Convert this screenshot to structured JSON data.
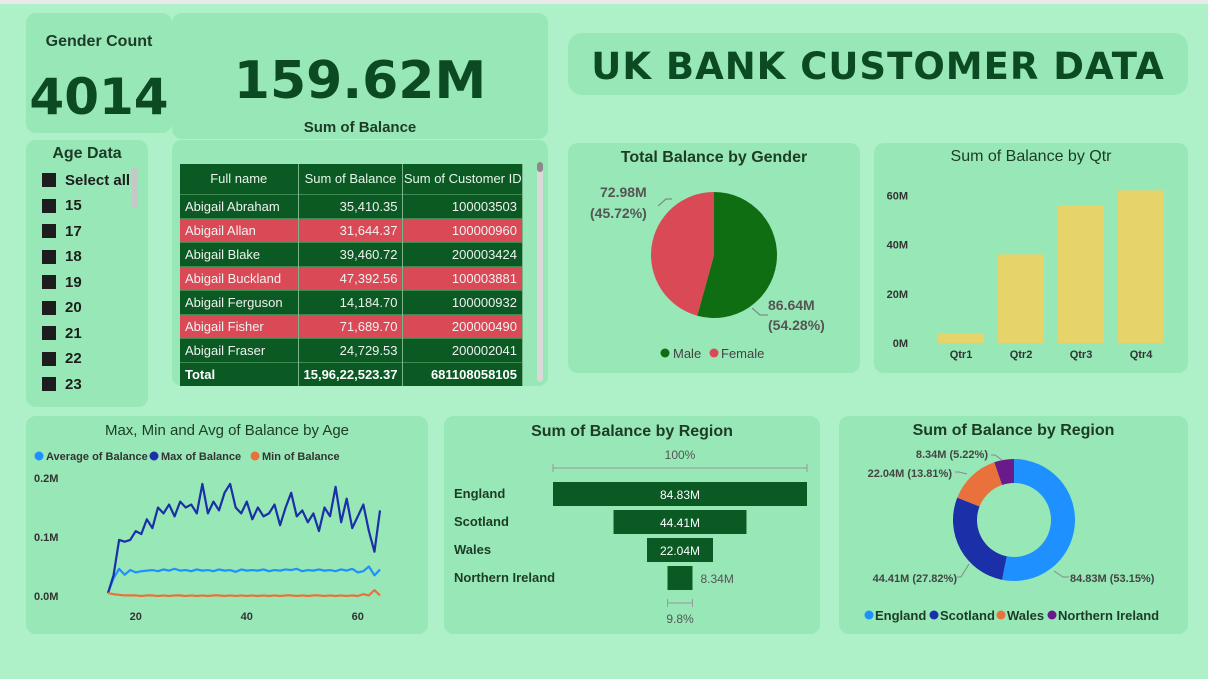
{
  "gender_count": {
    "title": "Gender Count",
    "value": "4014"
  },
  "balance_kpi": {
    "value": "159.62M",
    "label": "Sum of Balance"
  },
  "dashboard_title": "UK BANK CUSTOMER DATA",
  "age_filter": {
    "title": "Age Data",
    "items": [
      "Select all",
      "15",
      "17",
      "18",
      "19",
      "20",
      "21",
      "22",
      "23"
    ]
  },
  "customer_table": {
    "headers": [
      "Full name",
      "Sum of Balance",
      "Sum of Customer ID"
    ],
    "rows": [
      {
        "name": "Abigail Abraham",
        "balance": "35,410.35",
        "id": "100003503",
        "flag": "g"
      },
      {
        "name": "Abigail Allan",
        "balance": "31,644.37",
        "id": "100000960",
        "flag": "r"
      },
      {
        "name": "Abigail Blake",
        "balance": "39,460.72",
        "id": "200003424",
        "flag": "g"
      },
      {
        "name": "Abigail Buckland",
        "balance": "47,392.56",
        "id": "100003881",
        "flag": "r"
      },
      {
        "name": "Abigail Ferguson",
        "balance": "14,184.70",
        "id": "100000932",
        "flag": "g"
      },
      {
        "name": "Abigail Fisher",
        "balance": "71,689.70",
        "id": "200000490",
        "flag": "r"
      },
      {
        "name": "Abigail Fraser",
        "balance": "24,729.53",
        "id": "200002041",
        "flag": "g"
      }
    ],
    "total": {
      "label": "Total",
      "balance": "15,96,22,523.37",
      "id": "681108058105"
    }
  },
  "colors": {
    "male": "#0f6e12",
    "female": "#d94a56",
    "bar": "#e6d36a",
    "avg": "#1e90ff",
    "max": "#1a2fa8",
    "min": "#e8713c",
    "england": "#1e90ff",
    "scotland": "#1a2fa8",
    "wales": "#e8713c",
    "ni": "#6a1a8a",
    "funnel": "#0b5a24"
  },
  "chart_data": [
    {
      "type": "pie",
      "title": "Total Balance by Gender",
      "labels": [
        "Male",
        "Female"
      ],
      "values": [
        86.64,
        72.98
      ],
      "value_labels": [
        "86.64M",
        "72.98M"
      ],
      "percent_labels": [
        "(54.28%)",
        "(45.72%)"
      ],
      "percents": [
        54.28,
        45.72
      ],
      "legend": "bottom"
    },
    {
      "type": "bar",
      "title": "Sum of Balance by Qtr",
      "categories": [
        "Qtr1",
        "Qtr2",
        "Qtr3",
        "Qtr4"
      ],
      "values": [
        4,
        36,
        56,
        62
      ],
      "y_ticks": [
        "0M",
        "20M",
        "40M",
        "60M"
      ],
      "ylim": [
        0,
        65
      ]
    },
    {
      "type": "line",
      "title": "Max, Min and Avg of Balance by Age",
      "series_names": [
        "Average of Balance",
        "Max of Balance",
        "Min of Balance"
      ],
      "x_ticks": [
        "20",
        "40",
        "60"
      ],
      "y_ticks": [
        "0.0M",
        "0.1M",
        "0.2M"
      ],
      "xlim": [
        15,
        64
      ],
      "ylim": [
        0,
        0.2
      ],
      "x": [
        15,
        16,
        17,
        18,
        19,
        20,
        21,
        22,
        23,
        24,
        25,
        26,
        27,
        28,
        29,
        30,
        31,
        32,
        33,
        34,
        35,
        36,
        37,
        38,
        39,
        40,
        41,
        42,
        43,
        44,
        45,
        46,
        47,
        48,
        49,
        50,
        51,
        52,
        53,
        54,
        55,
        56,
        57,
        58,
        59,
        60,
        61,
        62,
        63,
        64
      ],
      "series": [
        {
          "name": "Average of Balance",
          "values": [
            0.005,
            0.03,
            0.046,
            0.036,
            0.044,
            0.04,
            0.042,
            0.043,
            0.044,
            0.042,
            0.045,
            0.043,
            0.046,
            0.043,
            0.044,
            0.042,
            0.045,
            0.043,
            0.044,
            0.042,
            0.045,
            0.043,
            0.044,
            0.041,
            0.045,
            0.043,
            0.044,
            0.043,
            0.045,
            0.042,
            0.044,
            0.043,
            0.045,
            0.044,
            0.046,
            0.042,
            0.044,
            0.043,
            0.045,
            0.043,
            0.044,
            0.042,
            0.045,
            0.043,
            0.046,
            0.04,
            0.042,
            0.05,
            0.035,
            0.045
          ]
        },
        {
          "name": "Max of Balance",
          "values": [
            0.005,
            0.035,
            0.095,
            0.092,
            0.095,
            0.11,
            0.105,
            0.13,
            0.115,
            0.15,
            0.14,
            0.155,
            0.135,
            0.16,
            0.15,
            0.155,
            0.14,
            0.19,
            0.14,
            0.16,
            0.145,
            0.175,
            0.19,
            0.15,
            0.14,
            0.16,
            0.13,
            0.15,
            0.135,
            0.14,
            0.155,
            0.12,
            0.15,
            0.175,
            0.135,
            0.145,
            0.125,
            0.14,
            0.11,
            0.15,
            0.135,
            0.185,
            0.125,
            0.165,
            0.115,
            0.135,
            0.155,
            0.11,
            0.075,
            0.145
          ]
        },
        {
          "name": "Min of Balance",
          "values": [
            0.005,
            0.003,
            0.002,
            0.001,
            0.001,
            0.001,
            0.0,
            0.001,
            0.001,
            0.0,
            0.001,
            0.0,
            0.001,
            0.001,
            0.0,
            0.001,
            0.0,
            0.001,
            0.0,
            0.001,
            0.001,
            0.0,
            0.001,
            0.0,
            0.001,
            0.0,
            0.001,
            0.0,
            0.001,
            0.0,
            0.001,
            0.0,
            0.001,
            0.001,
            0.0,
            0.001,
            0.0,
            0.001,
            0.001,
            0.0,
            0.001,
            0.0,
            0.001,
            0.0,
            0.001,
            0.0,
            0.003,
            0.001,
            0.01,
            0.001
          ]
        }
      ],
      "legend": "top-left"
    },
    {
      "type": "funnel",
      "title": "Sum of Balance by Region",
      "categories": [
        "England",
        "Scotland",
        "Wales",
        "Northern Ireland"
      ],
      "values": [
        84.83,
        44.41,
        22.04,
        8.34
      ],
      "value_labels": [
        "84.83M",
        "44.41M",
        "22.04M",
        "8.34M"
      ],
      "top_label": "100%",
      "bottom_label": "9.8%"
    },
    {
      "type": "donut",
      "title": "Sum of Balance by Region",
      "labels": [
        "England",
        "Scotland",
        "Wales",
        "Northern Ireland"
      ],
      "values": [
        84.83,
        44.41,
        22.04,
        8.34
      ],
      "slice_labels": [
        "84.83M (53.15%)",
        "44.41M (27.82%)",
        "22.04M (13.81%)",
        "8.34M (5.22%)"
      ],
      "percents": [
        53.15,
        27.82,
        13.81,
        5.22
      ],
      "legend": "bottom"
    }
  ]
}
